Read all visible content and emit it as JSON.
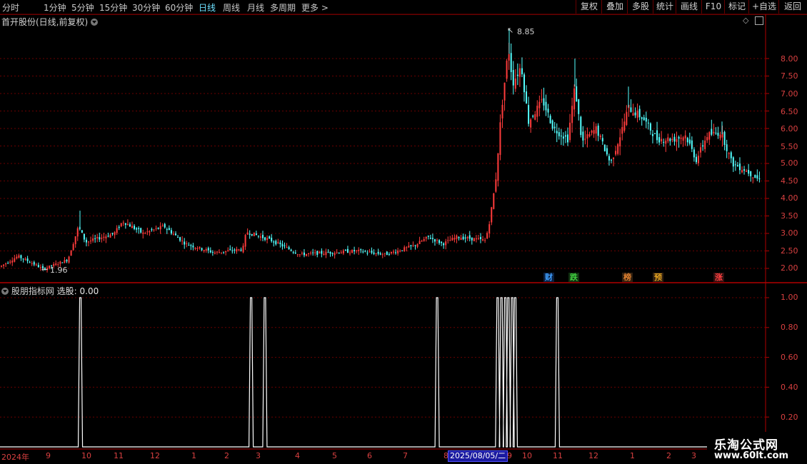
{
  "toolbar": {
    "periods": [
      "分时",
      "1分钟",
      "5分钟",
      "15分钟",
      "30分钟",
      "60分钟",
      "日线",
      "周线",
      "月线",
      "多周期",
      "更多"
    ],
    "active_period": "日线",
    "more_chevron": ">",
    "buttons": [
      "复权",
      "叠加",
      "多股",
      "统计",
      "画线",
      "F10",
      "标记",
      "+自选",
      "返回"
    ]
  },
  "main_chart": {
    "title": "首开股份(日线,前复权)",
    "y_ticks": [
      "8.00",
      "7.50",
      "7.00",
      "6.50",
      "6.00",
      "5.50",
      "5.00",
      "4.50",
      "4.00",
      "3.50",
      "3.00",
      "2.50",
      "2.00"
    ],
    "high_label": "8.85",
    "low_label": "1.96",
    "news_badges": [
      {
        "text": "财",
        "color": "#40a0ff"
      },
      {
        "text": "跌",
        "color": "#40c040"
      },
      {
        "text": "榜",
        "color": "#e07020"
      },
      {
        "text": "预",
        "color": "#e0a020"
      },
      {
        "text": "涨",
        "color": "#ff4040"
      }
    ],
    "up_color": "#ff3c3c",
    "down_color": "#54ffff"
  },
  "indicator": {
    "name": "股朋指标网",
    "label": "选股:",
    "value": "0.00",
    "y_ticks": [
      "1.00",
      "0.80",
      "0.60",
      "0.40",
      "0.20"
    ],
    "signal_x_fractions": [
      0.105,
      0.328,
      0.346,
      0.571,
      0.65,
      0.655,
      0.66,
      0.664,
      0.669,
      0.673,
      0.728
    ]
  },
  "date_axis": {
    "labels": [
      "2024年",
      "9",
      "10",
      "11",
      "12",
      "1",
      "2",
      "3",
      "4",
      "5",
      "6",
      "7",
      "8",
      "9",
      "10",
      "11",
      "12",
      "1",
      "2",
      "3"
    ],
    "cursor": "2025/08/05/二"
  },
  "watermark": {
    "name": "乐淘公式网",
    "url": "www.60lt.com"
  }
}
